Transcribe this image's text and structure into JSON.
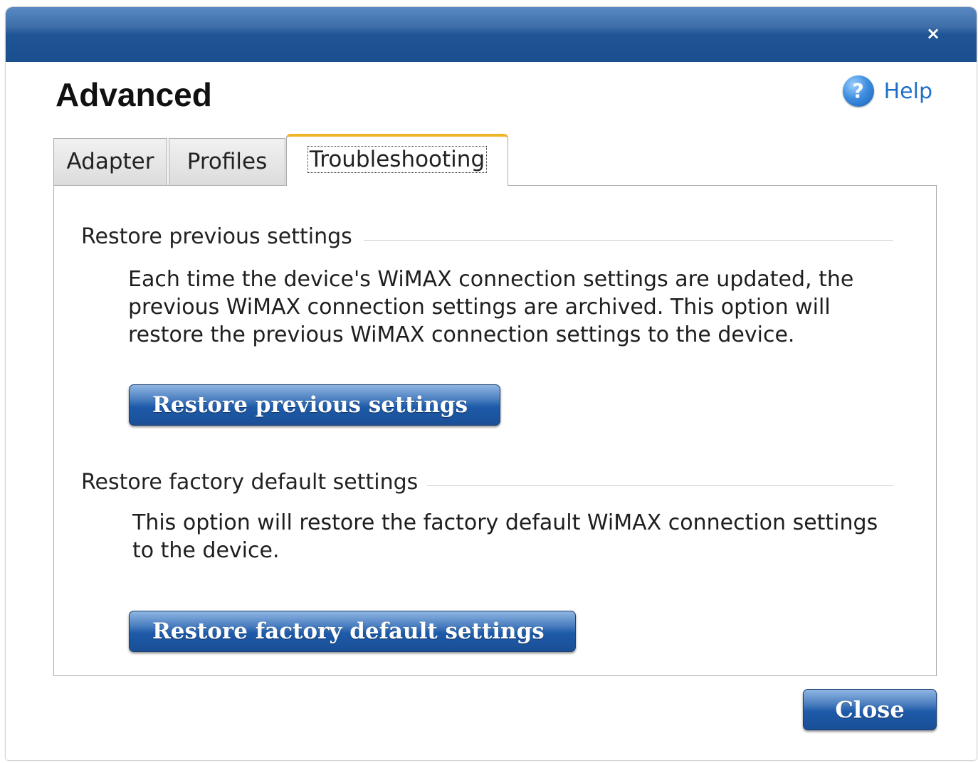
{
  "window": {
    "close_glyph": "×",
    "title": "Advanced"
  },
  "help": {
    "icon": "help-icon",
    "icon_glyph": "?",
    "label": "Help"
  },
  "tabs": [
    {
      "label": "Adapter",
      "active": false
    },
    {
      "label": "Profiles",
      "active": false
    },
    {
      "label": "Troubleshooting",
      "active": true
    }
  ],
  "restore_previous": {
    "heading": "Restore previous settings",
    "description": "Each time the device's WiMAX connection settings are updated, the\nprevious WiMAX connection settings are archived.   This option will\nrestore the previous WiMAX connection settings to the device.",
    "button_label": "Restore previous settings"
  },
  "restore_factory": {
    "heading": "Restore factory default settings",
    "description": "This option will restore the factory default WiMAX connection settings\nto the device.",
    "button_label": "Restore factory default settings"
  },
  "footer": {
    "close_label": "Close"
  },
  "colors": {
    "titlebar": "#1f5495",
    "active_tab_accent": "#f0b429",
    "button_blue": "#1d5aa8",
    "help_link": "#1f6fc9"
  }
}
